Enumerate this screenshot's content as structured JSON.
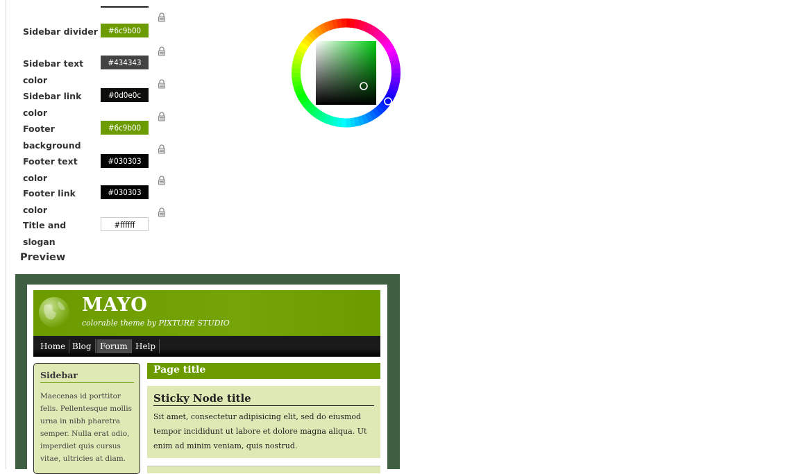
{
  "color_settings": [
    {
      "label": "Sidebar divider",
      "value": "#6c9b00",
      "bg": "#6c9b00",
      "fg": "#ffffff"
    },
    {
      "label": "Sidebar text color",
      "value": "#434343",
      "bg": "#434343",
      "fg": "#ffffff"
    },
    {
      "label": "Sidebar link color",
      "value": "#0d0e0c",
      "bg": "#0d0e0c",
      "fg": "#ffffff"
    },
    {
      "label": "Footer background",
      "value": "#6c9b00",
      "bg": "#6c9b00",
      "fg": "#ffffff"
    },
    {
      "label": "Footer text color",
      "value": "#030303",
      "bg": "#030303",
      "fg": "#ffffff"
    },
    {
      "label": "Footer link color",
      "value": "#030303",
      "bg": "#030303",
      "fg": "#ffffff"
    },
    {
      "label": "Title and slogan",
      "value": "#ffffff",
      "bg": "#ffffff",
      "fg": "#000000"
    }
  ],
  "color_picker": {
    "selected_hue": "#00cc11",
    "icons": [
      "color-wheel-icon",
      "lock-icon"
    ]
  },
  "preview": {
    "heading": "Preview",
    "site_name": "MAYO",
    "slogan": "colorable theme by PIXTURE STUDIO",
    "nav": [
      "Home",
      "Blog",
      "Forum",
      "Help"
    ],
    "nav_active": "Forum",
    "sidebar_title": "Sidebar",
    "sidebar_text": "Maecenas id porttitor felis. Pellentesque mollis urna in nibh pharetra semper. Nulla erat odio, imperdiet quis cursus vitae, ultricies at diam.",
    "page_title": "Page title",
    "node_title": "Sticky Node title",
    "node_body": "Sit amet, consectetur adipisicing elit, sed do eiusmod tempor incididunt ut labore et dolore magna aliqua. Ut enim ad minim veniam, quis nostrud.",
    "colors": {
      "frame": "#3f5f42",
      "header": "#6c9b00",
      "sidebar_bg": "#dfe9b6"
    }
  }
}
